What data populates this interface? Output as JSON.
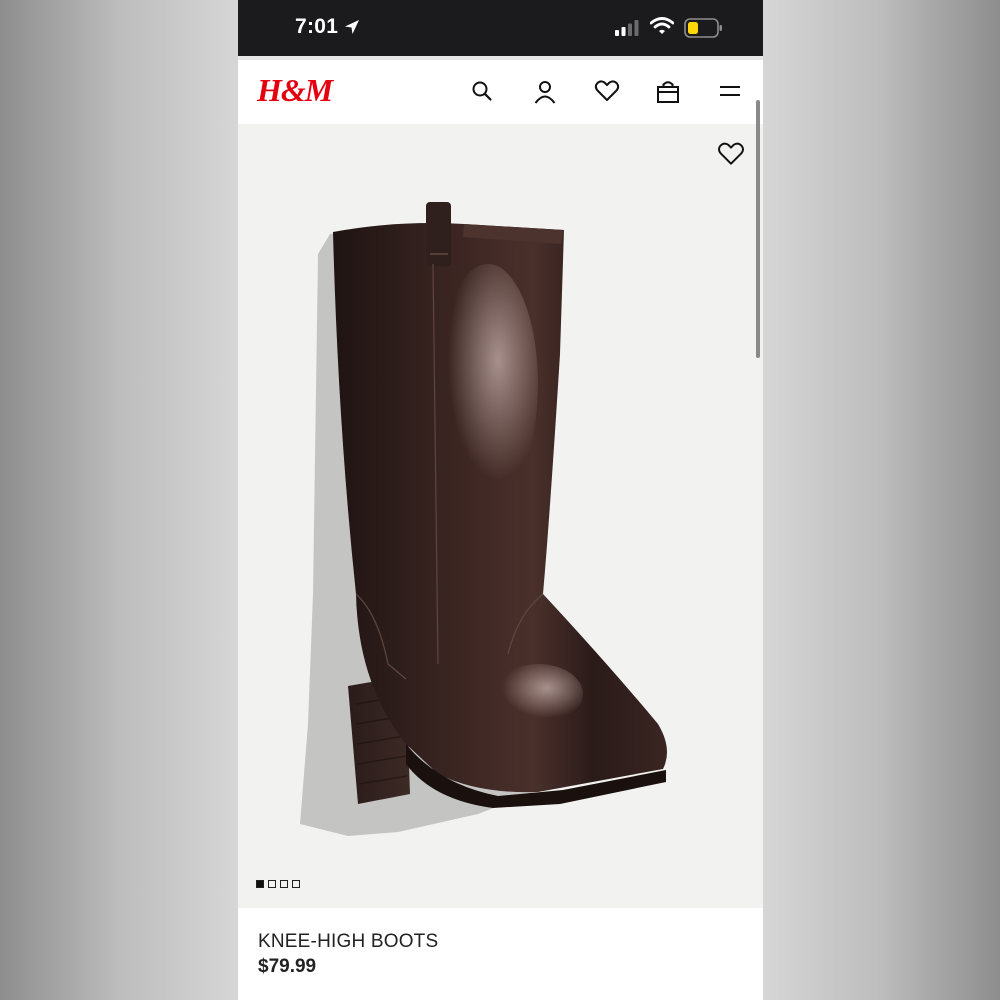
{
  "status_bar": {
    "time": "7:01",
    "icons": [
      "location-arrow-icon",
      "cellular-signal-icon",
      "wifi-icon",
      "battery-low-icon"
    ],
    "battery_color": "#ffd60a"
  },
  "header": {
    "logo_text": "H&M",
    "brand_color": "#e50010",
    "icons": [
      "search-icon",
      "account-icon",
      "favorites-heart-icon",
      "shopping-bag-icon",
      "menu-icon"
    ]
  },
  "product": {
    "name": "KNEE-HIGH BOOTS",
    "price": "$79.99",
    "image_count": 4,
    "active_image": 1,
    "image_background": "#f2f2f1",
    "boot_color": "#2e1d1b"
  }
}
